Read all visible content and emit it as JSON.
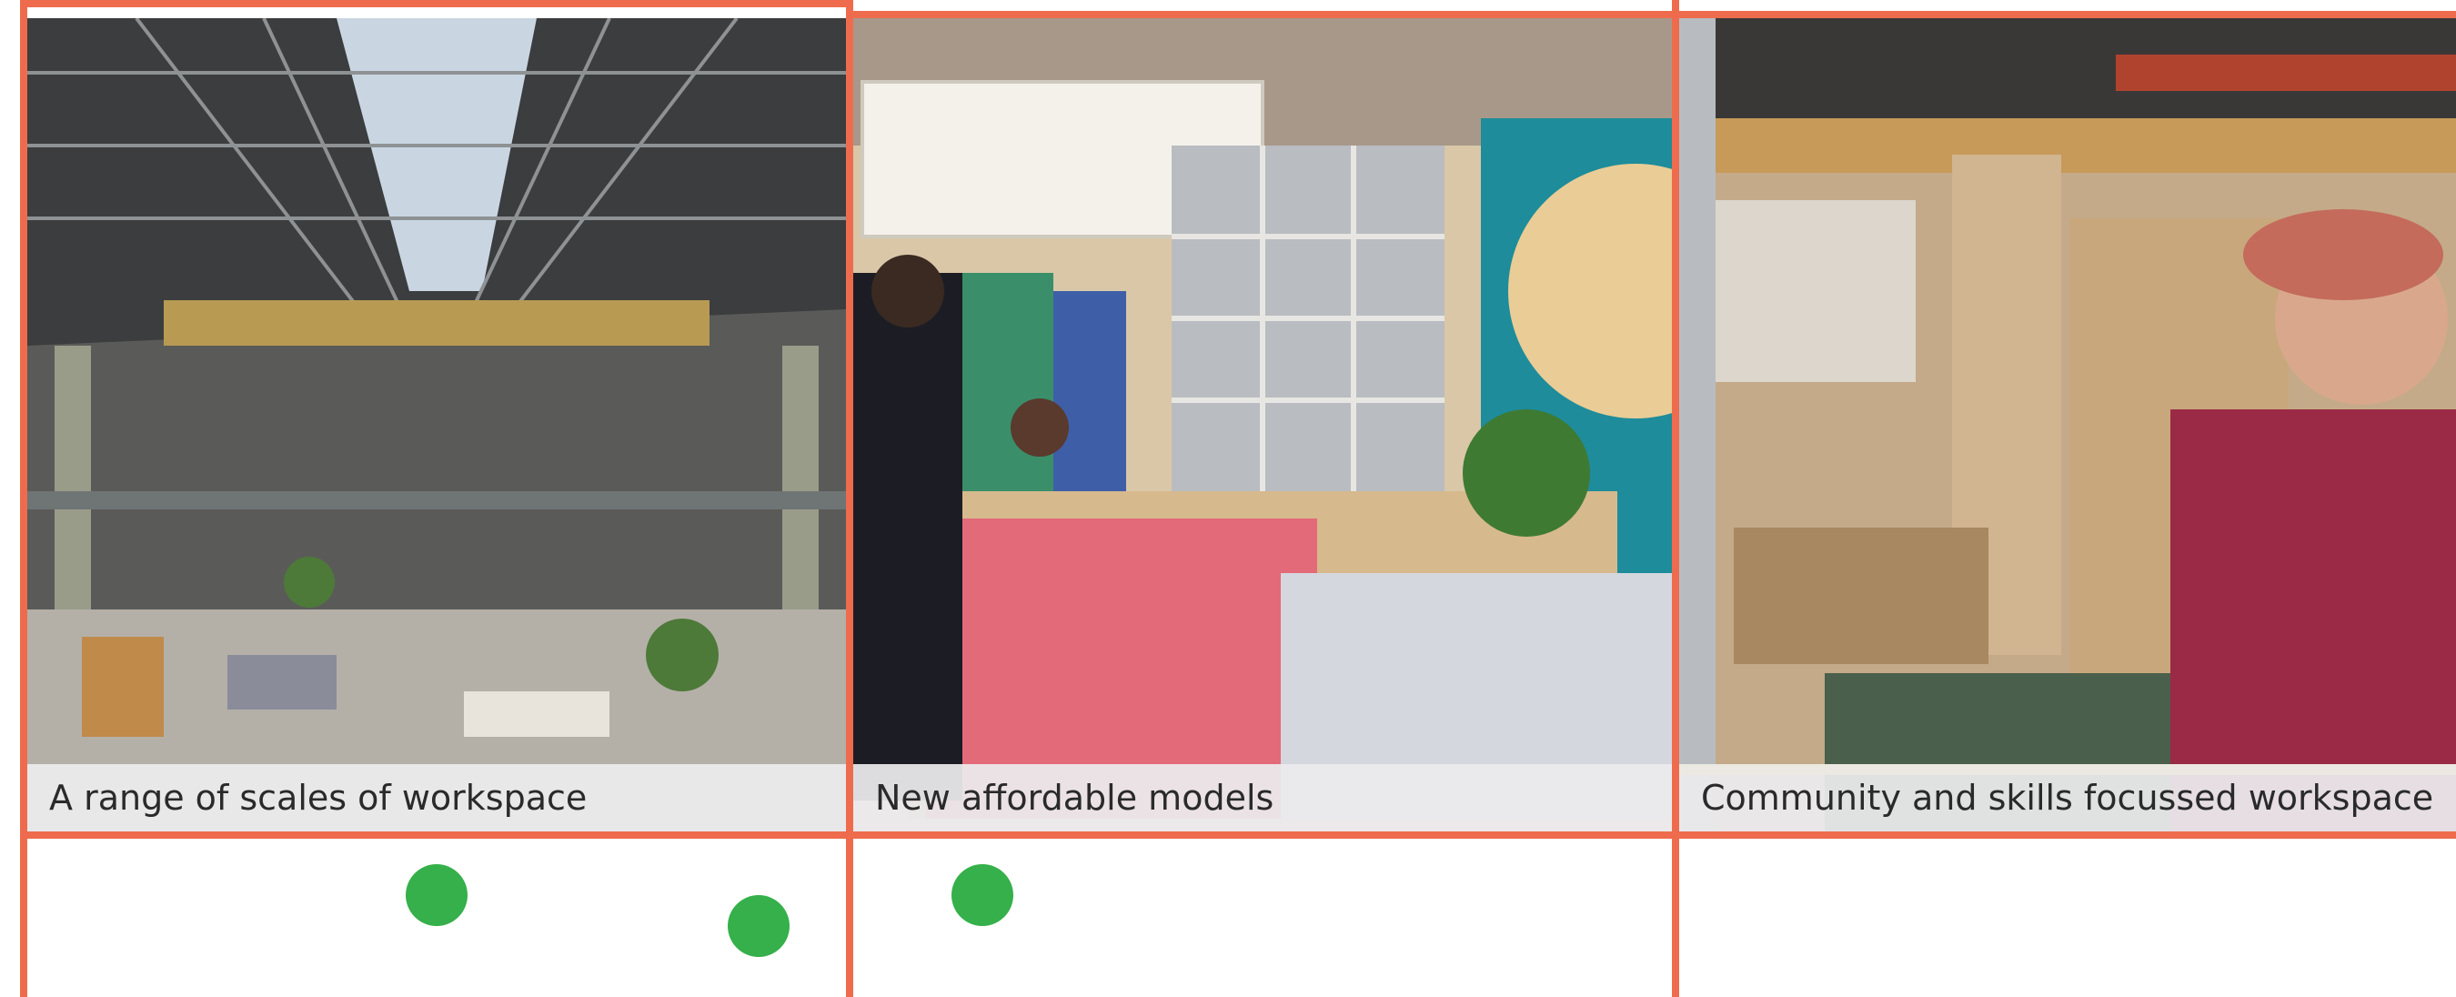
{
  "accent_color": "#ee6c4d",
  "dot_color": "#35b04a",
  "cards": [
    {
      "caption": "A range of scales of workspace",
      "image_desc": "industrial-warehouse-coworking-photo"
    },
    {
      "caption": "New affordable models",
      "image_desc": "reception-desk-photo"
    },
    {
      "caption": "Community and skills focussed workspace",
      "image_desc": "woodworking-workshop-photo"
    }
  ]
}
